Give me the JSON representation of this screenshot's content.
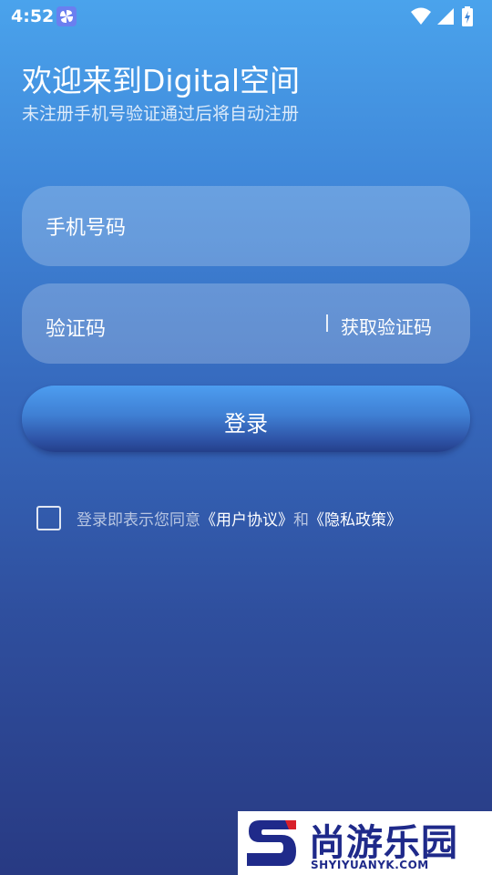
{
  "status_bar": {
    "time": "4:52",
    "icons": [
      "app-notification-icon",
      "wifi-icon",
      "signal-icon",
      "battery-charging-icon"
    ]
  },
  "header": {
    "title": "欢迎来到Digital空间",
    "subtitle": "未注册手机号验证通过后将自动注册"
  },
  "form": {
    "phone_placeholder": "手机号码",
    "code_placeholder": "验证码",
    "get_code_label": "获取验证码",
    "login_label": "登录"
  },
  "agreement": {
    "checked": false,
    "prefix": "登录即表示您同意",
    "user_agreement": "《用户协议》",
    "conjunction": "和",
    "privacy_policy": "《隐私政策》"
  },
  "watermark": {
    "name": "尚游乐园",
    "url": "SHYIYUANYK.COM"
  },
  "colors": {
    "background_top": "#4aa3ec",
    "background_bottom": "#283a83",
    "button": "#3f7fd3",
    "watermark_text": "#1f2a8a"
  }
}
